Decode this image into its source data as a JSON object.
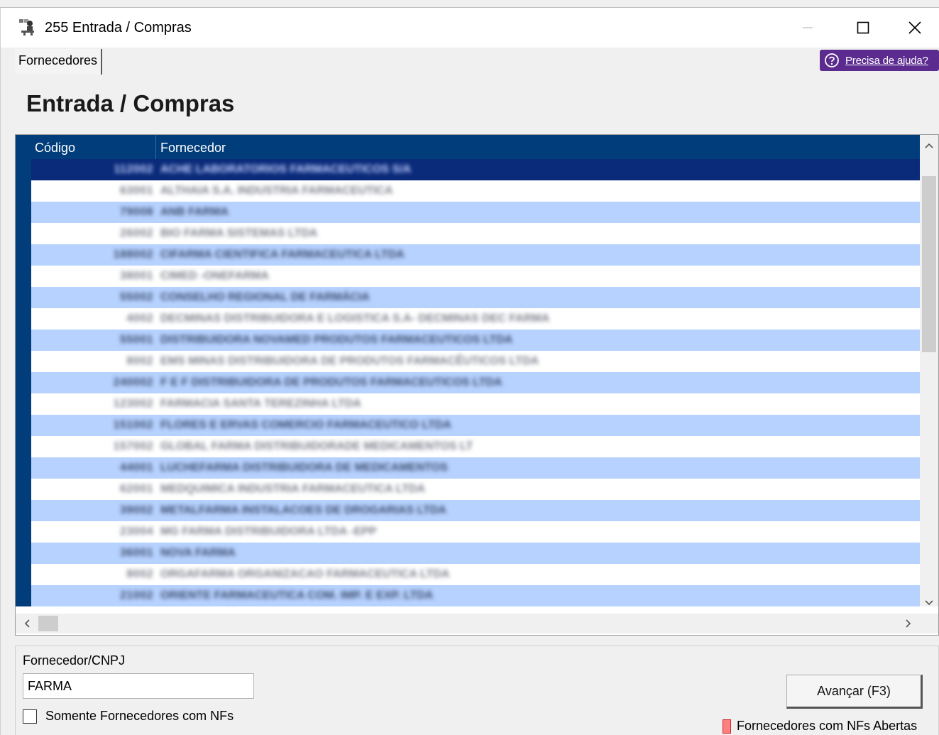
{
  "window": {
    "title": "255 Entrada / Compras",
    "controls": [
      "minimize-icon",
      "maximize-icon",
      "close-icon"
    ]
  },
  "tabs": [
    {
      "label": "Fornecedores",
      "active": true
    }
  ],
  "help": {
    "label": "Precisa de ajuda?",
    "icon": "help-circle-icon",
    "color": "#5b2b8f"
  },
  "page": {
    "title": "Entrada / Compras"
  },
  "grid": {
    "columns": [
      "Código",
      "Fornecedor"
    ],
    "header_color": "#003d7a",
    "row_alt_color": "#b7d2ff",
    "selected_row_color": "#0a2a7a",
    "selected_index": 0,
    "rows": [
      {
        "codigo": "112002",
        "fornecedor": "ACHE LABORATORIOS FARMACEUTICOS S/A"
      },
      {
        "codigo": "63001",
        "fornecedor": "ALTHAIA S.A. INDUSTRIA FARMACEUTICA"
      },
      {
        "codigo": "79008",
        "fornecedor": "ANB FARMA"
      },
      {
        "codigo": "26002",
        "fornecedor": "BIO FARMA SISTEMAS LTDA"
      },
      {
        "codigo": "188002",
        "fornecedor": "CIFARMA CIENTIFICA FARMACEUTICA LTDA"
      },
      {
        "codigo": "38001",
        "fornecedor": "CIMED -ONEFARMA"
      },
      {
        "codigo": "55002",
        "fornecedor": "CONSELHO REGIONAL DE FARMÁCIA"
      },
      {
        "codigo": "4002",
        "fornecedor": "DECMINAS DISTRIBUIDORA E LOGISTICA S.A- DECMINAS DEC FARMA"
      },
      {
        "codigo": "55001",
        "fornecedor": "DISTRIBUIDORA NOVAMED PRODUTOS FARMACEUTICOS LTDA"
      },
      {
        "codigo": "8002",
        "fornecedor": "EMS MINAS DISTRIBUIDORA DE PRODUTOS FARMACÊUTICOS LTDA"
      },
      {
        "codigo": "240002",
        "fornecedor": "F E F DISTRIBUIDORA DE PRODUTOS FARMACEUTICOS LTDA"
      },
      {
        "codigo": "123002",
        "fornecedor": "FARMACIA SANTA TEREZINHA LTDA"
      },
      {
        "codigo": "151002",
        "fornecedor": "FLORES E ERVAS COMERCIO FARMACEUTICO LTDA"
      },
      {
        "codigo": "157002",
        "fornecedor": "GLOBAL FARMA DISTRIBUIDORADE MEDICAMENTOS LT"
      },
      {
        "codigo": "44001",
        "fornecedor": "LUCHEFARMA DISTRIBUIDORA DE MEDICAMENTOS"
      },
      {
        "codigo": "62001",
        "fornecedor": "MEDQUIMICA INDUSTRIA FARMACEUTICA LTDA"
      },
      {
        "codigo": "39002",
        "fornecedor": "METALFARMA INSTALACOES DE DROGARIAS LTDA"
      },
      {
        "codigo": "23004",
        "fornecedor": "MG FARMA DISTRIBUIDORA LTDA -EPP"
      },
      {
        "codigo": "36001",
        "fornecedor": "NOVA FARMA"
      },
      {
        "codigo": "8002",
        "fornecedor": "ORGAFARMA ORGANIZACAO FARMACEUTICA LTDA"
      },
      {
        "codigo": "21002",
        "fornecedor": "ORIENTE FARMACEUTICA COM. IMP. E EXP. LTDA"
      }
    ]
  },
  "search": {
    "label": "Fornecedor/CNPJ",
    "value": "FARMA"
  },
  "filter": {
    "label": "Somente Fornecedores com NFs",
    "checked": false
  },
  "advance_button": {
    "label": "Avançar (F3)"
  },
  "legend": {
    "label": "Fornecedores com NFs Abertas",
    "color": "#ff8080"
  }
}
